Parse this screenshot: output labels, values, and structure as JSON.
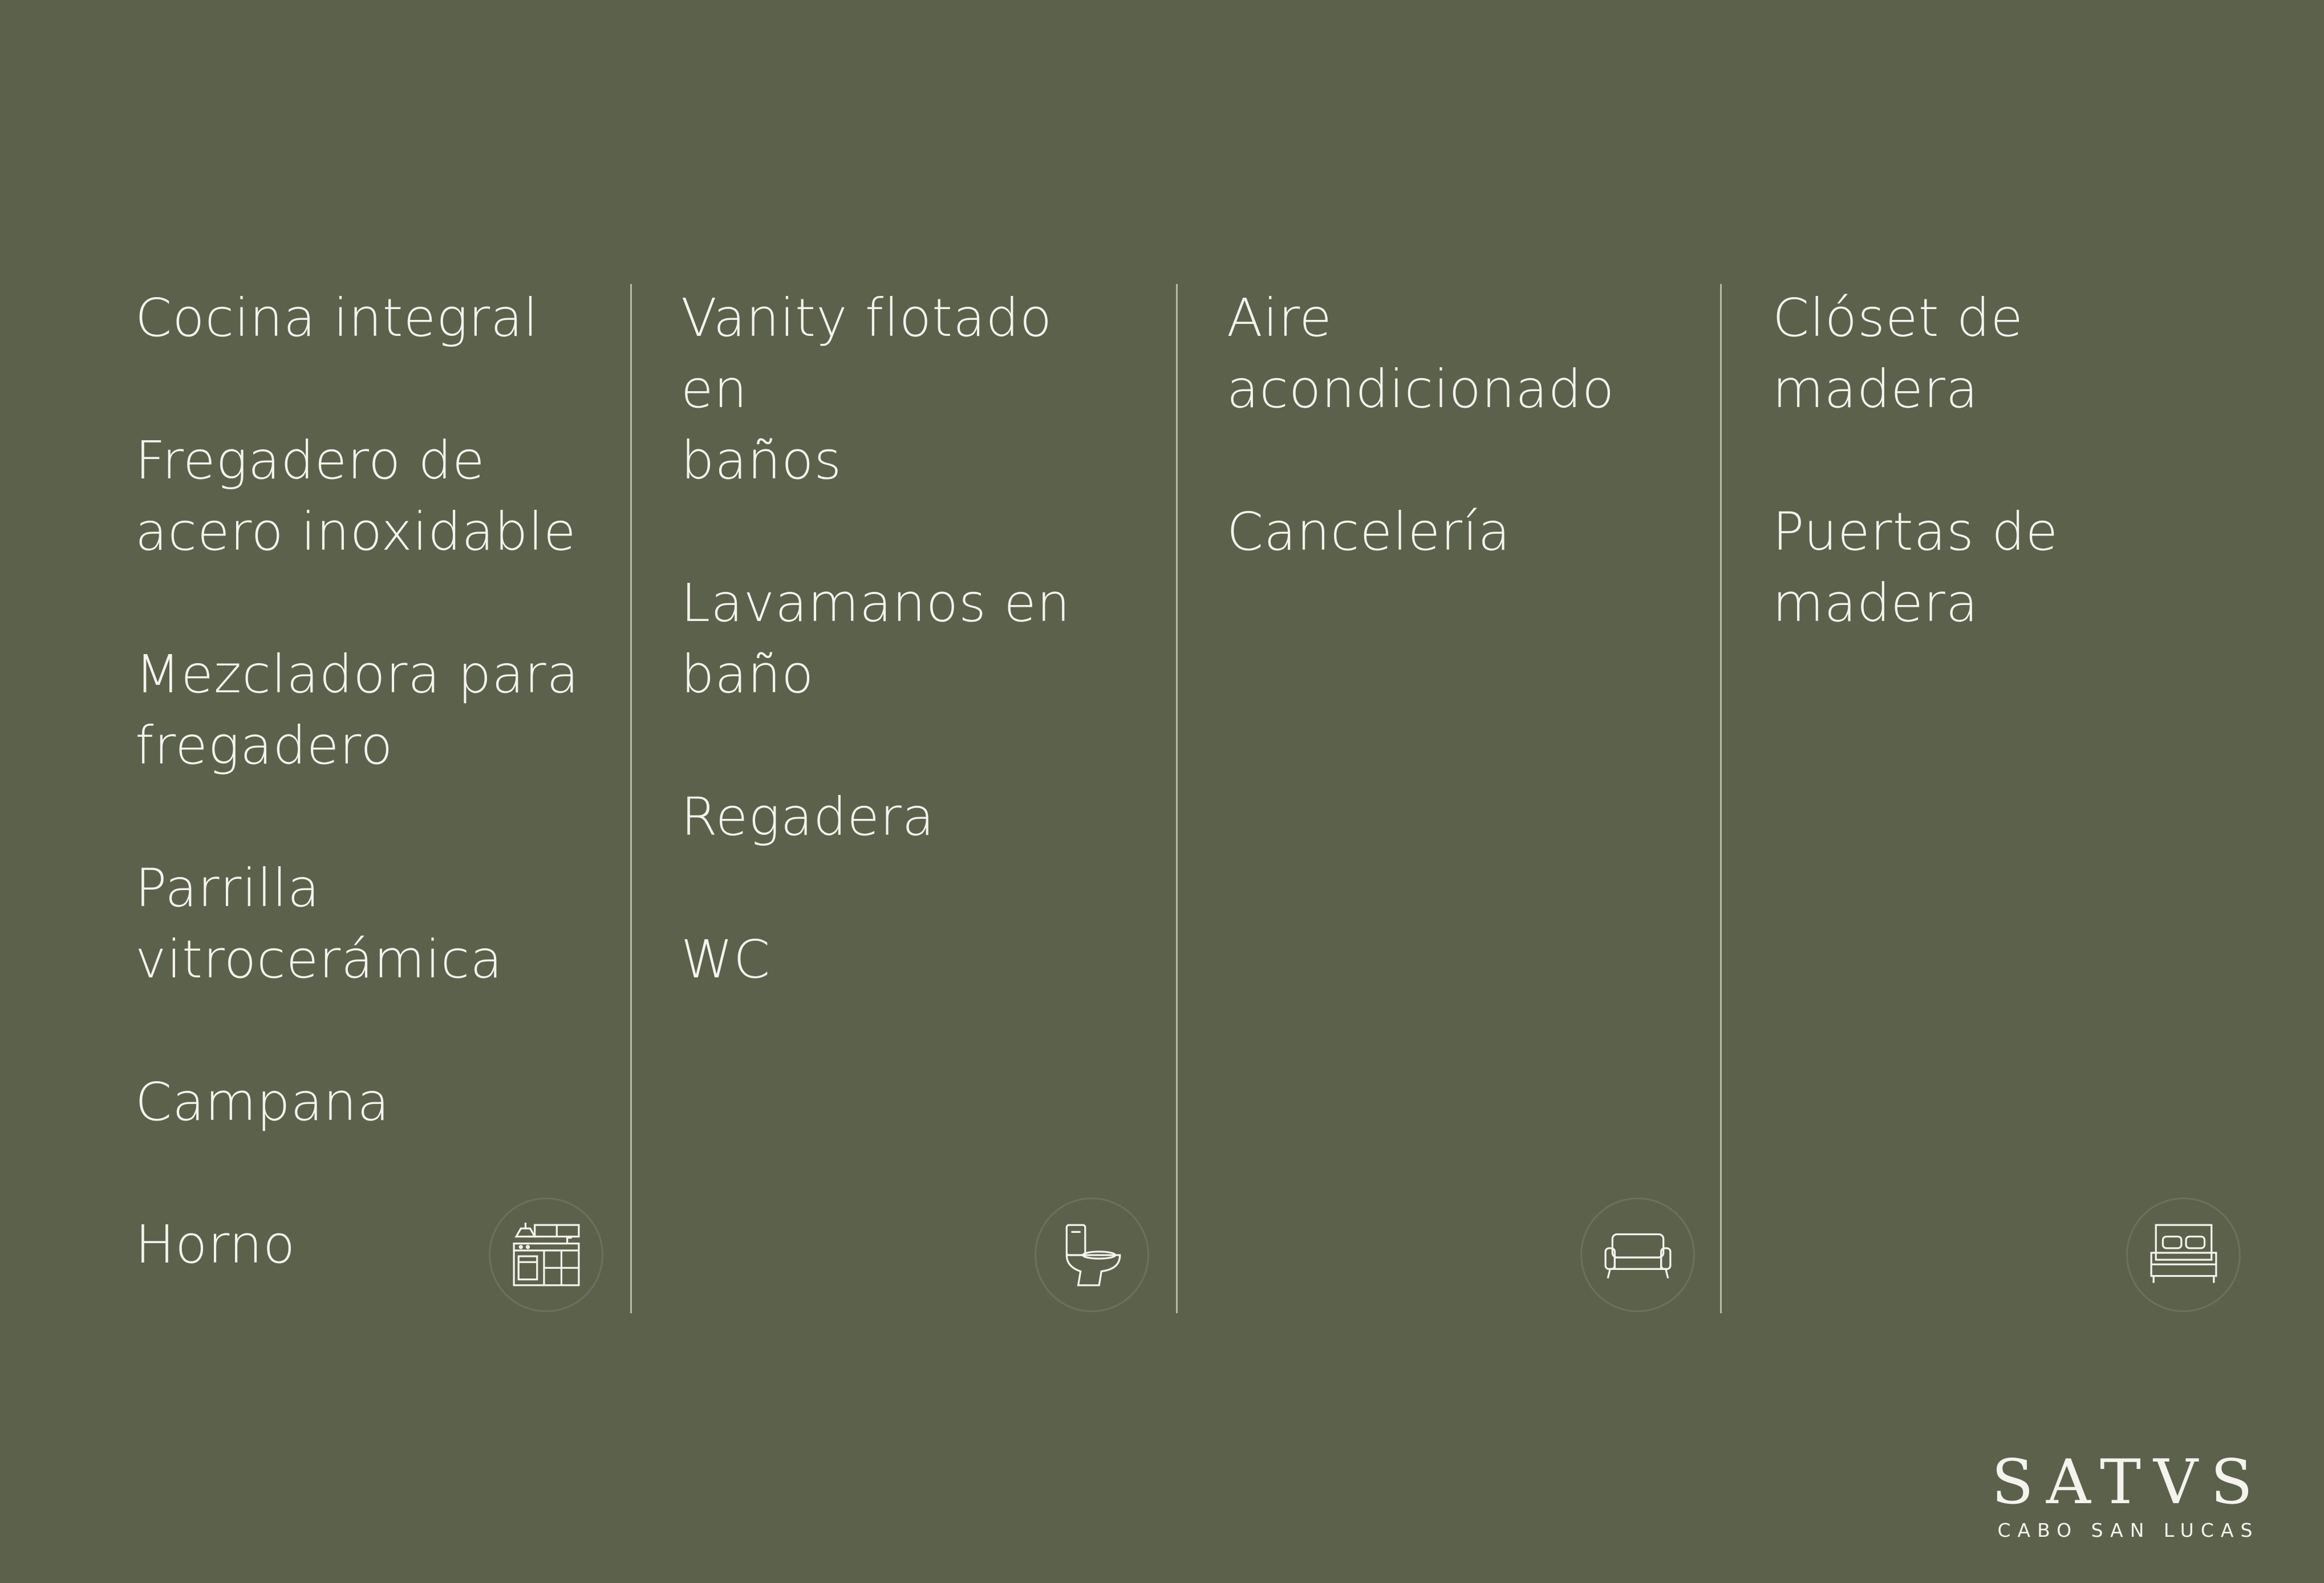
{
  "columns": [
    {
      "items": [
        "Cocina integral",
        "Fregadero de\nacero inoxidable",
        "Mezcladora para\nfregadero",
        "Parrilla\nvitrocerámica",
        "Campana",
        "Horno"
      ],
      "icon": "kitchen-icon"
    },
    {
      "items": [
        "Vanity flotado en\nbaños",
        "Lavamanos en\nbaño",
        "Regadera",
        "WC"
      ],
      "icon": "toilet-icon"
    },
    {
      "items": [
        "Aire\nacondicionado",
        "Cancelería"
      ],
      "icon": "sofa-icon"
    },
    {
      "items": [
        "Clóset de\nmadera",
        "Puertas de\nmadera"
      ],
      "icon": "bed-icon"
    }
  ],
  "logo": {
    "word": "SATVS",
    "subtitle": "CABO SAN LUCAS"
  },
  "colors": {
    "background": "#5c614b",
    "text": "#f4f3ee"
  }
}
